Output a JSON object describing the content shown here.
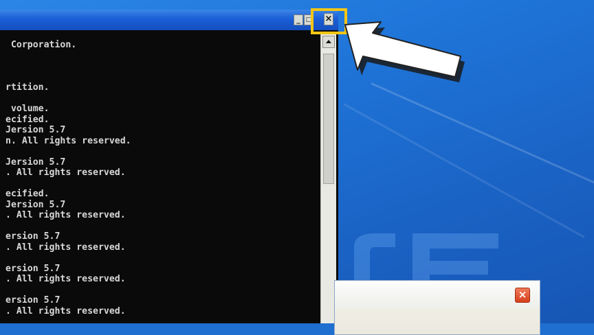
{
  "console": {
    "lines": [
      " Corporation.",
      "",
      "",
      "",
      "rtition.",
      "",
      " volume.",
      "ecified.",
      "Jersion 5.7",
      "n. All rights reserved.",
      "",
      "Jersion 5.7",
      ". All rights reserved.",
      "",
      "ecified.",
      "Jersion 5.7",
      ". All rights reserved.",
      "",
      "ersion 5.7",
      ". All rights reserved.",
      "",
      "ersion 5.7",
      ". All rights reserved.",
      "",
      "ersion 5.7",
      ". All rights reserved."
    ]
  },
  "window_buttons": {
    "minimize": "_",
    "maximize": "□",
    "close": "×"
  },
  "dialog": {
    "close_label": "×"
  },
  "colors": {
    "highlight": "#f2c615",
    "console_bg": "#0a0a0a",
    "console_text": "#d8d8d8",
    "titlebar": "#1b5ed6",
    "desktop": "#1f74d8",
    "dialog_close": "#d6401c"
  },
  "icons": [
    "pointer-arrow-icon",
    "scroll-up-arrow-icon"
  ]
}
